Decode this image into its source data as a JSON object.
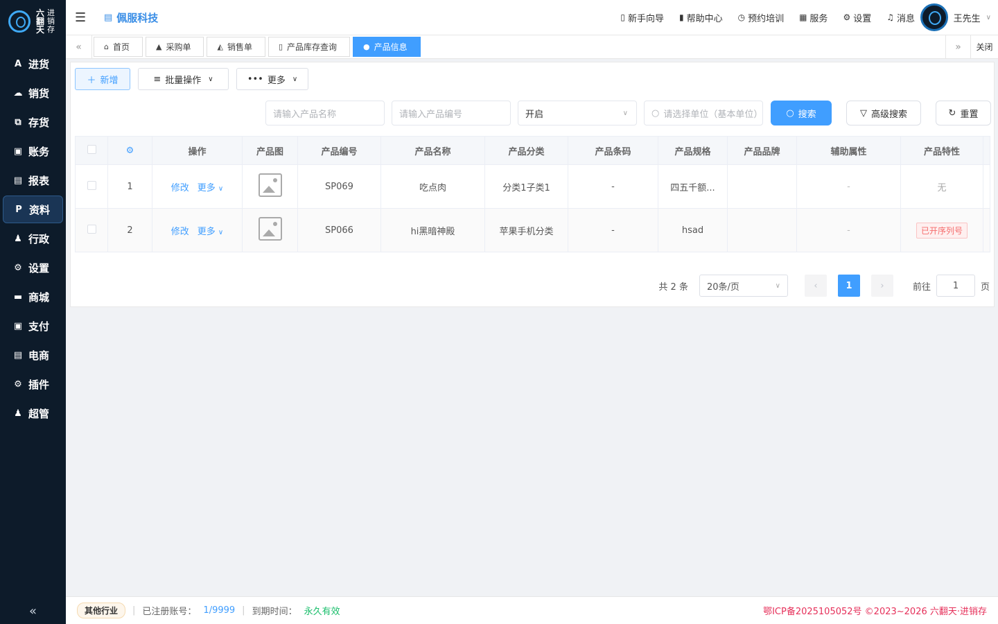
{
  "sidebar": {
    "logo": {
      "big": [
        "六",
        "翻",
        "天"
      ],
      "small": [
        "进",
        "销",
        "存"
      ]
    },
    "items": [
      {
        "label": "进货",
        "icon": "A"
      },
      {
        "label": "销货",
        "icon": "☁"
      },
      {
        "label": "存货",
        "icon": "⧉"
      },
      {
        "label": "账务",
        "icon": "▣"
      },
      {
        "label": "报表",
        "icon": "▤"
      },
      {
        "label": "资料",
        "icon": "P"
      },
      {
        "label": "行政",
        "icon": "♟"
      },
      {
        "label": "设置",
        "icon": "⚙"
      },
      {
        "label": "商城",
        "icon": "▬"
      },
      {
        "label": "支付",
        "icon": "▣"
      },
      {
        "label": "电商",
        "icon": "▤"
      },
      {
        "label": "插件",
        "icon": "⚙"
      },
      {
        "label": "超管",
        "icon": "♟"
      }
    ],
    "collapse": "«"
  },
  "topbar": {
    "company": "佩服科技",
    "links": [
      "新手向导",
      "帮助中心",
      "预约培训",
      "服务",
      "设置",
      "消息"
    ],
    "user": "王先生"
  },
  "tabs": {
    "items": [
      "首页",
      "采购单",
      "销售单",
      "产品库存查询",
      "产品信息"
    ],
    "close": "关闭"
  },
  "toolbar": {
    "add": "新增",
    "batch": "批量操作",
    "more": "更多"
  },
  "filters": {
    "name_placeholder": "请输入产品名称",
    "code_placeholder": "请输入产品编号",
    "status": "开启",
    "unit_placeholder": "请选择单位（基本单位）",
    "search": "搜索",
    "advanced": "高级搜索",
    "reset": "重置"
  },
  "table": {
    "headers": [
      "操作",
      "产品图",
      "产品编号",
      "产品名称",
      "产品分类",
      "产品条码",
      "产品规格",
      "产品品牌",
      "辅助属性",
      "产品特性"
    ],
    "edit": "修改",
    "more": "更多",
    "rows": [
      {
        "idx": "1",
        "code": "SP069",
        "name": "吃点肉",
        "category": "分类1子类1",
        "barcode": "-",
        "spec": "四五千额...",
        "brand": "",
        "aux": "-",
        "feature": "无"
      },
      {
        "idx": "2",
        "code": "SP066",
        "name": "hi黑暗神殿",
        "category": "苹果手机分类",
        "barcode": "-",
        "spec": "hsad",
        "brand": "",
        "aux": "-",
        "feature": "已开序列号"
      }
    ]
  },
  "pager": {
    "total": "共 2 条",
    "size": "20条/页",
    "current": "1",
    "goto": "前往",
    "page_input": "1",
    "page_suffix": "页"
  },
  "footer": {
    "industry": "其他行业",
    "registered_label": "已注册账号：",
    "registered_value": "1/9999",
    "expire_label": "到期时间：",
    "expire_value": "永久有效",
    "icp": "鄂ICP备2025105052号 ©2023~2026 六翻天·进销存"
  },
  "colors": {
    "accent": "#409eff",
    "sidebar": "#0d1b2a",
    "danger": "#f56c6c",
    "success": "#19be6b"
  }
}
